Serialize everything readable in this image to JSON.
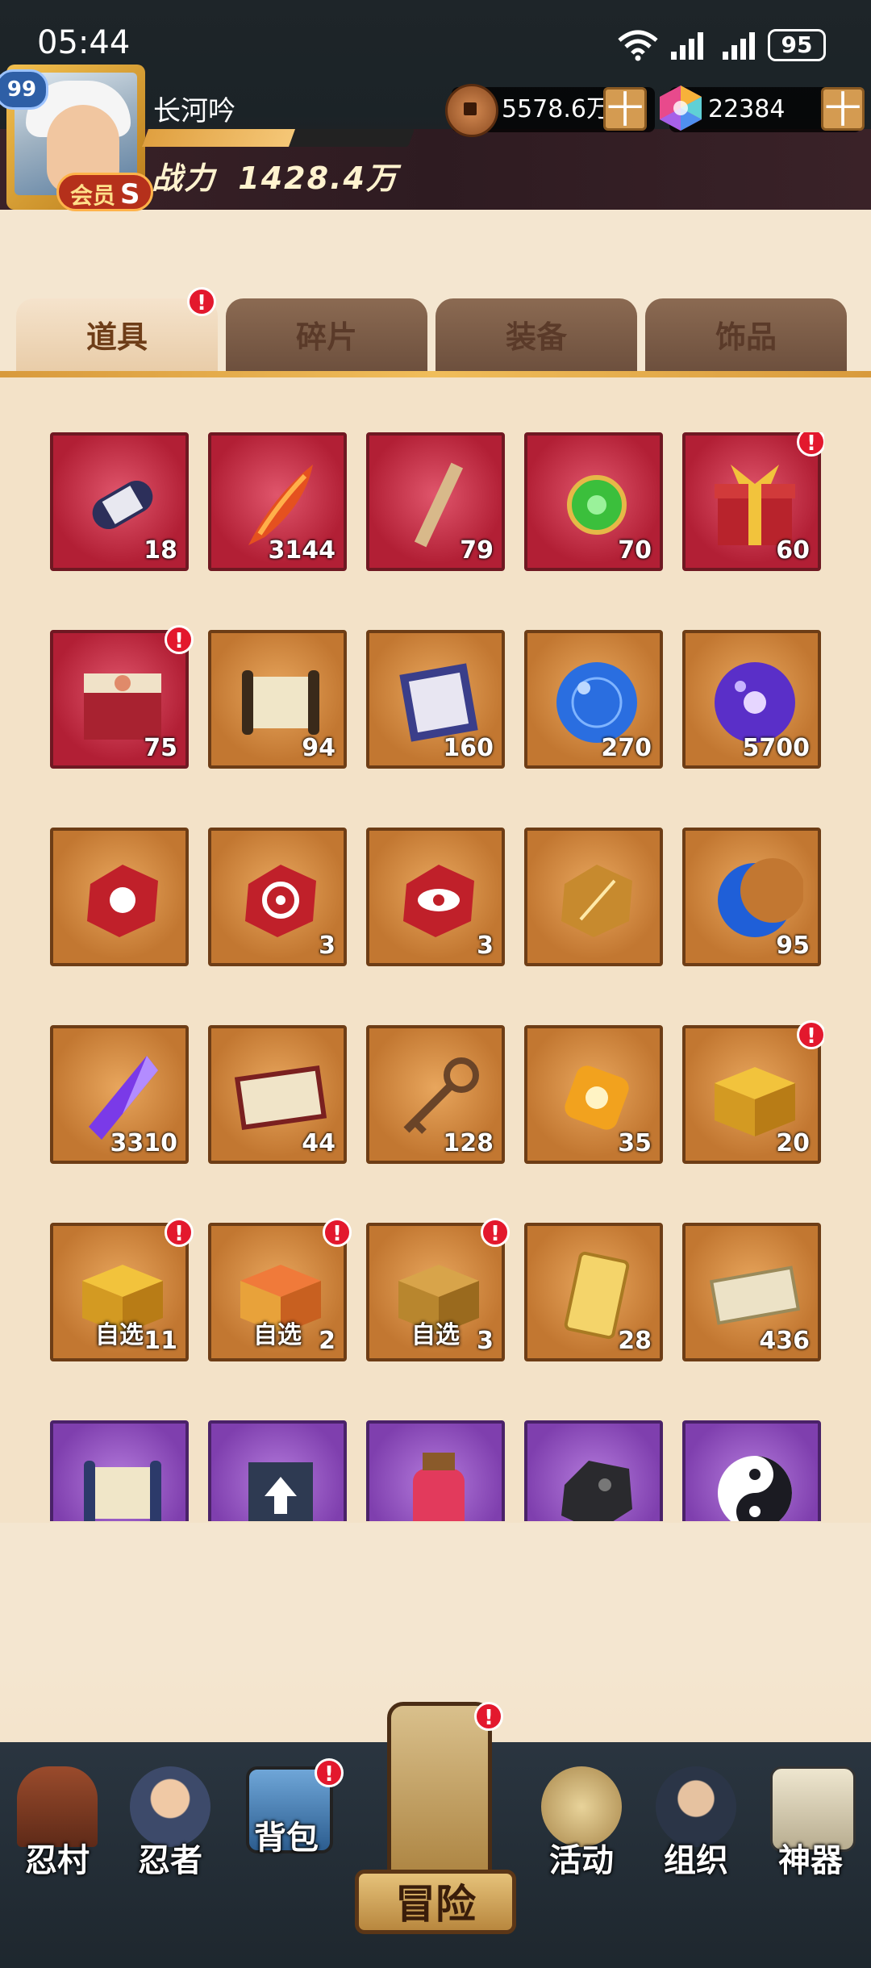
{
  "status_bar": {
    "time": "05:44",
    "battery": "95"
  },
  "player": {
    "level": "99",
    "name": "长河吟",
    "vip_label": "会员",
    "vip_level": "S",
    "power_label": "战力",
    "power_value": "1428.4万",
    "exp_progress": 0.55
  },
  "currencies": [
    {
      "icon": "copper-coin-icon",
      "value": "5578.6万",
      "add": "十"
    },
    {
      "icon": "rainbow-gem-icon",
      "value": "22384",
      "add": "十"
    }
  ],
  "tabs": [
    {
      "label": "道具",
      "active": true,
      "badge": "!"
    },
    {
      "label": "碎片",
      "active": false
    },
    {
      "label": "装备",
      "active": false
    },
    {
      "label": "饰品",
      "active": false
    }
  ],
  "items": [
    {
      "icon": "scroll-bundle-icon",
      "frame": "red",
      "count": "18"
    },
    {
      "icon": "flame-feather-icon",
      "frame": "red",
      "count": "3144"
    },
    {
      "icon": "wooden-tablet-icon",
      "frame": "red",
      "count": "79"
    },
    {
      "icon": "jade-pendant-icon",
      "frame": "red",
      "count": "70"
    },
    {
      "icon": "gift-box-icon",
      "frame": "red",
      "count": "60",
      "badge": "!"
    },
    {
      "icon": "treasure-chest-icon",
      "frame": "red",
      "count": "75",
      "badge": "!"
    },
    {
      "icon": "scroll-icon",
      "frame": "orange",
      "count": "94"
    },
    {
      "icon": "seal-paper-icon",
      "frame": "orange",
      "count": "160"
    },
    {
      "icon": "blue-orb-icon",
      "frame": "orange",
      "count": "270"
    },
    {
      "icon": "purple-orb-icon",
      "frame": "orange",
      "count": "5700"
    },
    {
      "icon": "red-fist-stone-icon",
      "frame": "orange",
      "count": ""
    },
    {
      "icon": "red-target-stone-icon",
      "frame": "orange",
      "count": "3"
    },
    {
      "icon": "red-eye-stone-icon",
      "frame": "orange",
      "count": "3"
    },
    {
      "icon": "gold-stone-icon",
      "frame": "orange",
      "count": ""
    },
    {
      "icon": "blue-moon-icon",
      "frame": "orange",
      "count": "95"
    },
    {
      "icon": "purple-crystal-icon",
      "frame": "orange",
      "count": "3310"
    },
    {
      "icon": "fortune-ticket-icon",
      "frame": "orange",
      "count": "44"
    },
    {
      "icon": "key-icon",
      "frame": "orange",
      "count": "128"
    },
    {
      "icon": "amber-stone-icon",
      "frame": "orange",
      "count": "35"
    },
    {
      "icon": "gold-box-icon",
      "frame": "orange",
      "count": "20",
      "badge": "!"
    },
    {
      "icon": "choice-box-a-icon",
      "frame": "orange",
      "count": "11",
      "tag": "自选",
      "badge": "!"
    },
    {
      "icon": "choice-box-b-icon",
      "frame": "orange",
      "count": "2",
      "tag": "自选",
      "badge": "!"
    },
    {
      "icon": "choice-box-c-icon",
      "frame": "orange",
      "count": "3",
      "tag": "自选",
      "badge": "!"
    },
    {
      "icon": "point-card-icon",
      "frame": "orange",
      "count": "28"
    },
    {
      "icon": "voucher-icon",
      "frame": "orange",
      "count": "436"
    },
    {
      "icon": "purple-scroll-icon",
      "frame": "purple",
      "count": ""
    },
    {
      "icon": "book-icon",
      "frame": "purple",
      "count": ""
    },
    {
      "icon": "potion-jar-icon",
      "frame": "purple",
      "count": ""
    },
    {
      "icon": "black-ore-icon",
      "frame": "purple",
      "count": ""
    },
    {
      "icon": "yin-yang-icon",
      "frame": "purple",
      "count": ""
    }
  ],
  "nav": [
    {
      "label": "忍村",
      "icon": "village-gate-icon"
    },
    {
      "label": "忍者",
      "icon": "ninja-icon"
    },
    {
      "label": "背包",
      "icon": "backpack-icon",
      "badge": "!"
    },
    {
      "label": "冒险",
      "icon": "adventure-scroll-icon",
      "badge": "!"
    },
    {
      "label": "活动",
      "icon": "drum-icon"
    },
    {
      "label": "组织",
      "icon": "organization-icon"
    },
    {
      "label": "神器",
      "icon": "artifact-book-icon"
    }
  ],
  "colors": {
    "accent": "#e3182d",
    "tab_active": "#f5e3cc",
    "frame_red": "#b21f35",
    "frame_orange": "#c27731",
    "frame_purple": "#7f3fae"
  }
}
